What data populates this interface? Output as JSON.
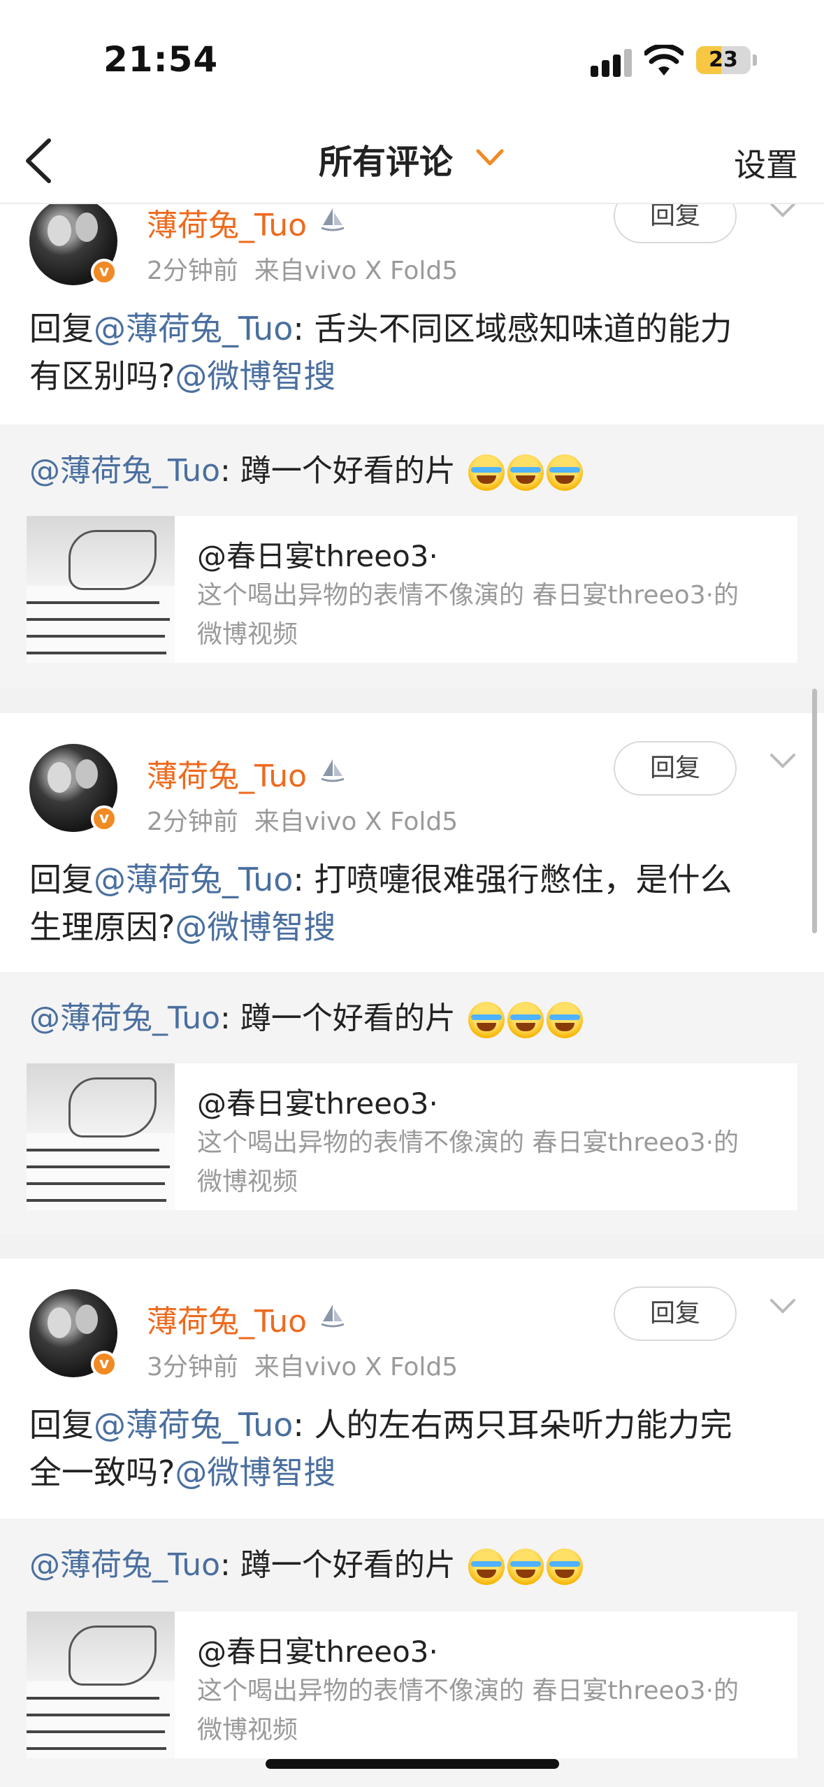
{
  "status_bar": {
    "time": "21:54",
    "battery": "23"
  },
  "nav": {
    "title": "所有评论",
    "settings": "设置"
  },
  "comments": [
    {
      "username": "薄荷兔_Tuo",
      "time": "2分钟前",
      "source": "来自vivo X Fold5",
      "reply_label": "回复",
      "text_prefix": "回复",
      "mention_user": "@薄荷兔_Tuo",
      "text_body": ": 舌头不同区域感知味道的能力",
      "text_line2": "有区别吗?",
      "mention_bot": "@微博智搜",
      "repost_user": "@薄荷兔_Tuo",
      "repost_text": ": 蹲一个好看的片",
      "card_title": "@春日宴threeo3·",
      "card_desc_1": "这个喝出异物的表情不像演的 春日宴threeo3·的",
      "card_desc_2": "微博视频"
    },
    {
      "username": "薄荷兔_Tuo",
      "time": "2分钟前",
      "source": "来自vivo X Fold5",
      "reply_label": "回复",
      "text_prefix": "回复",
      "mention_user": "@薄荷兔_Tuo",
      "text_body": ": 打喷嚏很难强行憋住，是什么",
      "text_line2": "生理原因?",
      "mention_bot": "@微博智搜",
      "repost_user": "@薄荷兔_Tuo",
      "repost_text": ": 蹲一个好看的片",
      "card_title": "@春日宴threeo3·",
      "card_desc_1": "这个喝出异物的表情不像演的 春日宴threeo3·的",
      "card_desc_2": "微博视频"
    },
    {
      "username": "薄荷兔_Tuo",
      "time": "3分钟前",
      "source": "来自vivo X Fold5",
      "reply_label": "回复",
      "text_prefix": "回复",
      "mention_user": "@薄荷兔_Tuo",
      "text_body": ": 人的左右两只耳朵听力能力完",
      "text_line2": "全一致吗?",
      "mention_bot": "@微博智搜",
      "repost_user": "@薄荷兔_Tuo",
      "repost_text": ": 蹲一个好看的片",
      "card_title": "@春日宴threeo3·",
      "card_desc_1": "这个喝出异物的表情不像演的 春日宴threeo3·的",
      "card_desc_2": "微博视频"
    }
  ],
  "icons": {
    "back": "chevron-left-icon",
    "title_dropdown": "chevron-down-icon",
    "more": "chevron-down-icon",
    "user_badge": "sailboat-badge-icon",
    "verified": "v-verified-icon"
  },
  "colors": {
    "username": "#ee6a1e",
    "mention": "#4a6f9f",
    "meta": "#9a9a9a",
    "verified": "#f08a24"
  }
}
